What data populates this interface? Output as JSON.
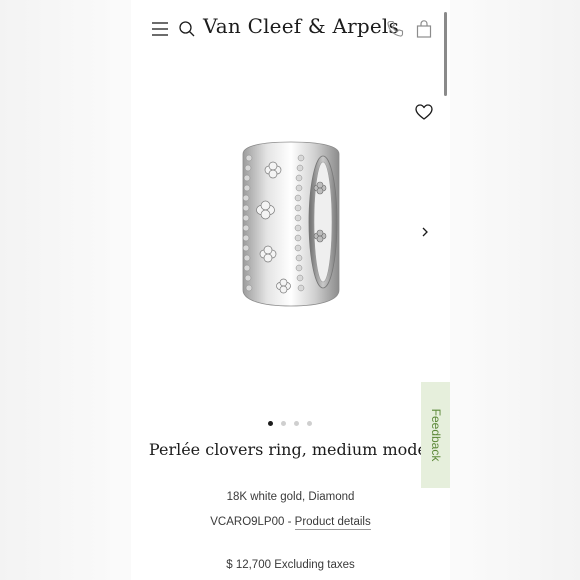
{
  "header": {
    "brand": "Van Cleef & Arpels",
    "icons": [
      "menu-icon",
      "search-icon",
      "phone-icon",
      "shopping-bag-icon"
    ]
  },
  "gallery": {
    "dot_count": 4,
    "active_dot": 0,
    "wishlist_icon": "heart-icon",
    "next_icon": "chevron-right-icon"
  },
  "product": {
    "title": "Perlée clovers ring, medium model",
    "material": "18K white gold, Diamond",
    "reference": "VCARO9LP00",
    "separator": "-",
    "details_link": "Product details",
    "price": "$ 12,700",
    "price_note": "Excluding taxes"
  },
  "feedback_tab": {
    "label": "Feedback"
  },
  "colors": {
    "text": "#1c1c1c",
    "feedback_bg": "#e6efdc",
    "feedback_text": "#5d8a3a"
  }
}
